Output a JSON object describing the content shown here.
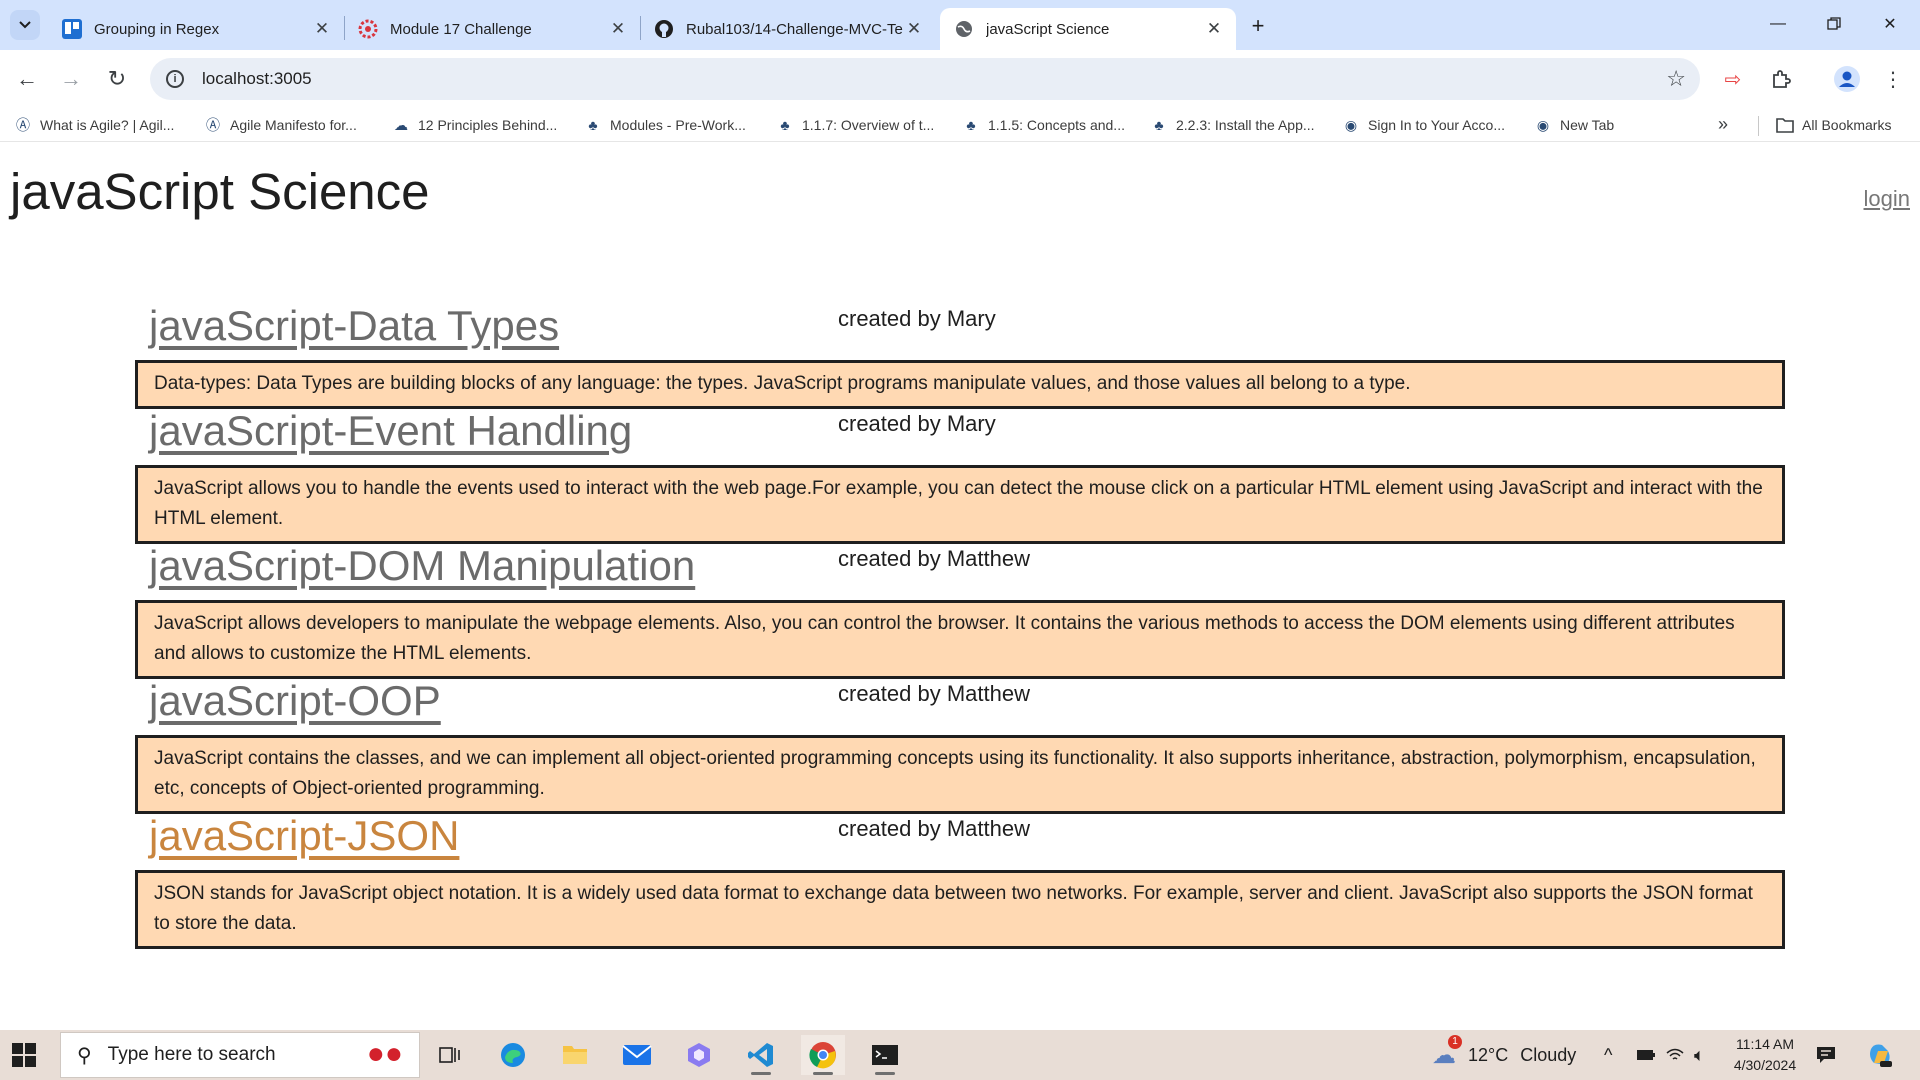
{
  "browser": {
    "tabs": [
      {
        "title": "Grouping in Regex",
        "icon": "trello-icon",
        "active": false
      },
      {
        "title": "Module 17 Challenge",
        "icon": "gear-flower-icon",
        "active": false
      },
      {
        "title": "Rubal103/14-Challenge-MVC-Te",
        "icon": "github-icon",
        "active": false
      },
      {
        "title": "javaScript Science",
        "icon": "globe-icon",
        "active": true
      }
    ],
    "address": "localhost:3005",
    "bookmarks": [
      {
        "label": "What is Agile? | Agil...",
        "icon": "agile-icon"
      },
      {
        "label": "Agile Manifesto for...",
        "icon": "agile-icon"
      },
      {
        "label": "12 Principles Behind...",
        "icon": "cloud-icon"
      },
      {
        "label": "Modules - Pre-Work...",
        "icon": "tree-icon"
      },
      {
        "label": "1.1.7: Overview of t...",
        "icon": "tree-icon"
      },
      {
        "label": "1.1.5: Concepts and...",
        "icon": "tree-icon"
      },
      {
        "label": "2.2.3: Install the App...",
        "icon": "tree-icon"
      },
      {
        "label": "Sign In to Your Acco...",
        "icon": "globe-icon"
      },
      {
        "label": "New Tab",
        "icon": "globe-icon"
      }
    ],
    "all_bookmarks": "All Bookmarks"
  },
  "site": {
    "title": "javaScript Science",
    "login": "login"
  },
  "posts": [
    {
      "title": "javaScript-Data Types",
      "author": "created by Mary",
      "content": "Data-types: Data Types are building blocks of any language: the types. JavaScript programs manipulate values, and those values all belong to a type.",
      "visited": false
    },
    {
      "title": "javaScript-Event Handling",
      "author": "created by Mary",
      "content": "JavaScript allows you to handle the events used to interact with the web page.For example, you can detect the mouse click on a particular HTML element using JavaScript and interact with the HTML element.",
      "visited": false
    },
    {
      "title": "javaScript-DOM Manipulation",
      "author": "created by Matthew",
      "content": "JavaScript allows developers to manipulate the webpage elements. Also, you can control the browser. It contains the various methods to access the DOM elements using different attributes and allows to customize the HTML elements.",
      "visited": false
    },
    {
      "title": "javaScript-OOP",
      "author": "created by Matthew",
      "content": "JavaScript contains the classes, and we can implement all object-oriented programming concepts using its functionality. It also supports inheritance, abstraction, polymorphism, encapsulation, etc, concepts of Object-oriented programming.",
      "visited": false
    },
    {
      "title": "javaScript-JSON",
      "author": "created by Matthew",
      "content": "JSON stands for JavaScript object notation. It is a widely used data format to exchange data between two networks. For example, server and client. JavaScript also supports the JSON format to store the data.",
      "visited": true
    }
  ],
  "taskbar": {
    "search_placeholder": "Type here to search",
    "weather_temp": "12°C",
    "weather_desc": "Cloudy",
    "weather_badge": "1",
    "time": "11:14 AM",
    "date": "4/30/2024"
  },
  "colors": {
    "content_bg": "#ffd9b3",
    "visited_link": "#c9853e",
    "link": "#6b6b6b",
    "tabstrip_bg": "#d3e3fd"
  }
}
